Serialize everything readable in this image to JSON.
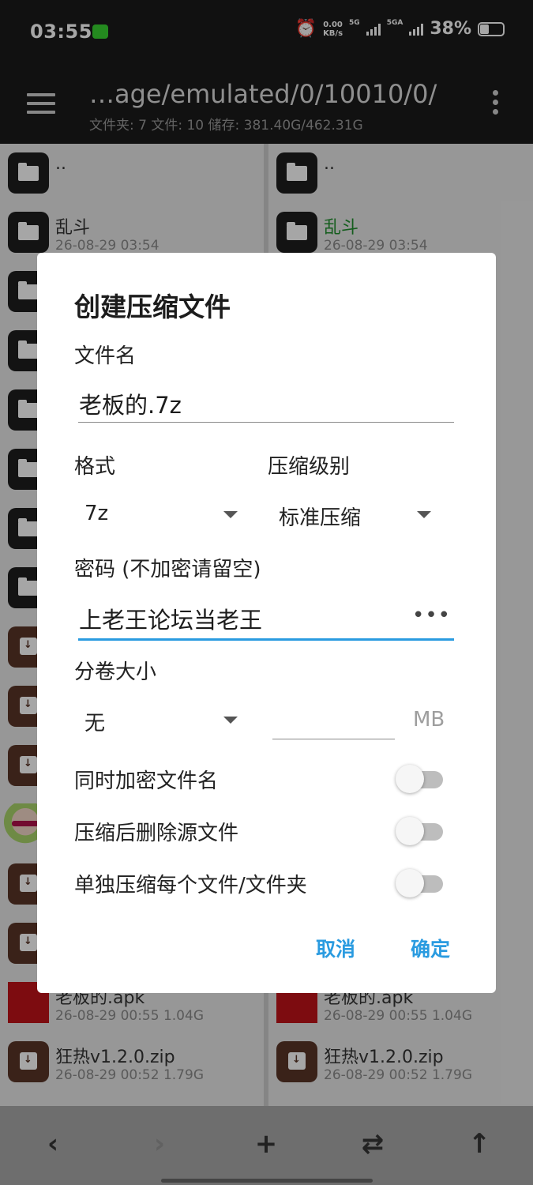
{
  "status_bar": {
    "time": "03:55",
    "net_speed_value": "0.00",
    "net_speed_unit": "KB/s",
    "net1": "5G",
    "net2": "5GA",
    "battery": "38%"
  },
  "app_bar": {
    "path": "…age/emulated/0/10010/0/",
    "subtitle": "文件夹: 7  文件: 10  储存: 381.40G/462.31G"
  },
  "left_pane": {
    "rows": [
      {
        "name": "..",
        "meta": "",
        "icon": "folder-icon"
      },
      {
        "name": "乱斗",
        "meta": "26-08-29 03:54",
        "icon": "folder-icon"
      }
    ],
    "bottom_rows": [
      {
        "name": "老板的.apk",
        "meta": "26-08-29 00:55  1.04G",
        "icon": "apk-icon"
      },
      {
        "name": "狂热v1.2.0.zip",
        "meta": "26-08-29 00:52  1.79G",
        "icon": "archive-icon"
      }
    ]
  },
  "right_pane": {
    "rows": [
      {
        "name": "..",
        "meta": "",
        "icon": "folder-icon"
      },
      {
        "name": "乱斗",
        "meta": "26-08-29 03:54",
        "icon": "folder-icon"
      }
    ],
    "bottom_rows": [
      {
        "name": "老板的.apk",
        "meta": "26-08-29 00:55  1.04G",
        "icon": "apk-icon"
      },
      {
        "name": "狂热v1.2.0.zip",
        "meta": "26-08-29 00:52  1.79G",
        "icon": "archive-icon"
      }
    ]
  },
  "dialog": {
    "title": "创建压缩文件",
    "filename_label": "文件名",
    "filename_value": "老板的.7z",
    "format_label": "格式",
    "format_value": "7z",
    "level_label": "压缩级别",
    "level_value": "标准压缩",
    "password_label": "密码 (不加密请留空)",
    "password_value": "上老王论坛当老王",
    "password_toggle": "•••",
    "volume_label": "分卷大小",
    "volume_value": "无",
    "volume_size_value": "",
    "volume_unit": "MB",
    "encrypt_names_label": "同时加密文件名",
    "encrypt_names_on": false,
    "delete_source_label": "压缩后删除源文件",
    "delete_source_on": false,
    "separate_label": "单独压缩每个文件/文件夹",
    "separate_on": false,
    "cancel_label": "取消",
    "ok_label": "确定"
  },
  "bottom_bar": {
    "back_icon": "‹",
    "forward_icon": "›",
    "add_icon": "+",
    "swap_icon": "⇄",
    "up_icon": "↑"
  },
  "colors": {
    "accent": "#2a9be0",
    "highlight_name": "#1f8f2d",
    "bar_bg": "#1b1b1b"
  }
}
